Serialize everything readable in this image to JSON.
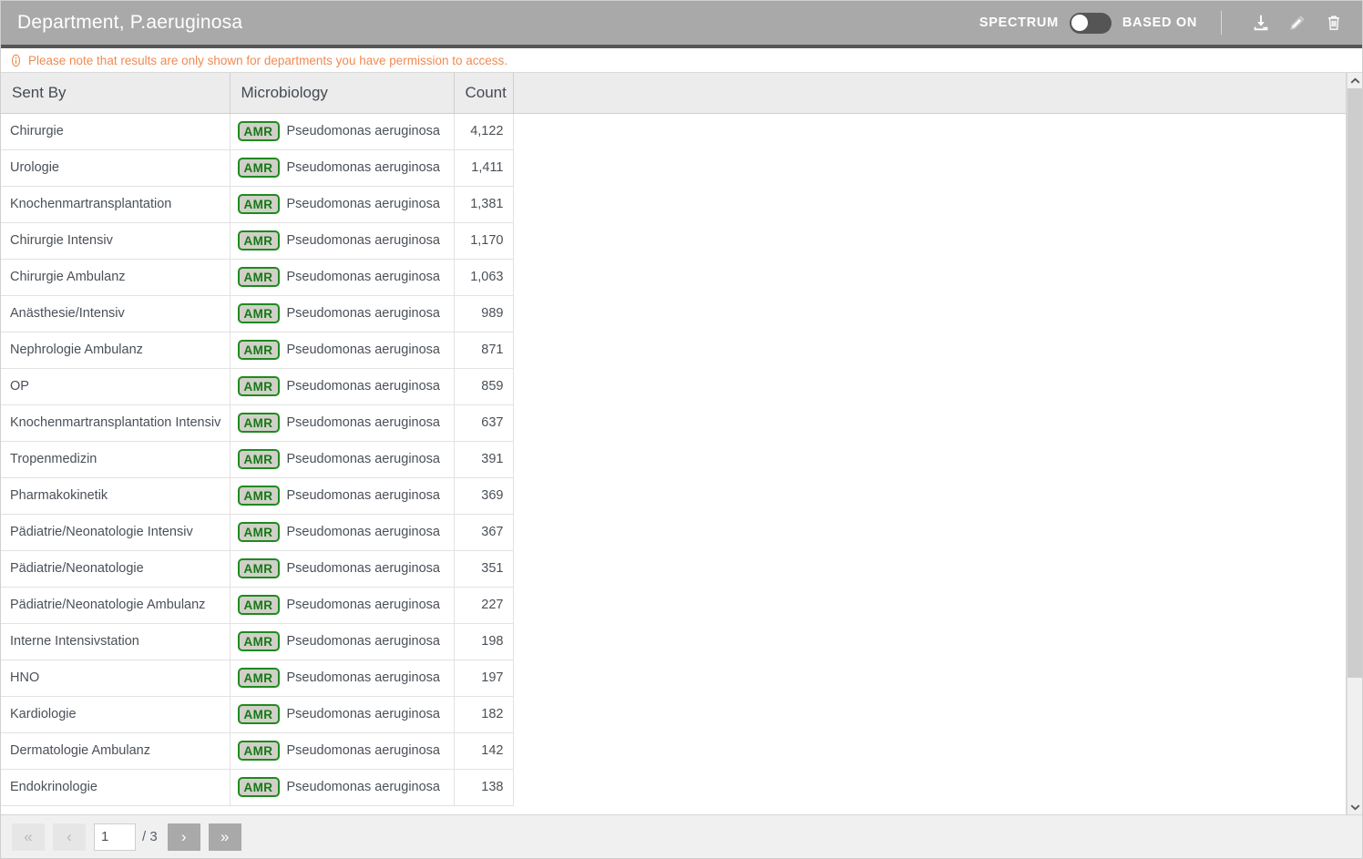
{
  "header": {
    "title": "Department, P.aeruginosa",
    "spectrum_label": "SPECTRUM",
    "based_on_label": "BASED ON",
    "toggle_state": "off",
    "icons": [
      "download-icon",
      "edit-icon",
      "delete-icon"
    ],
    "bar_color": "#a9a9a9",
    "title_color": "#ffffff"
  },
  "notice": {
    "icon": "info-icon",
    "text": "Please note that results are only shown for departments you have permission to access.",
    "color": "#f08a52"
  },
  "table": {
    "columns": [
      "Sent By",
      "Microbiology",
      "Count",
      ""
    ],
    "badge_label": "AMR",
    "badge_border_color": "#1f8a1f",
    "badge_text_color": "#147814",
    "rows": [
      {
        "sent_by": "Chirurgie",
        "badge": "AMR",
        "organism": "Pseudomonas aeruginosa",
        "count": "4,122"
      },
      {
        "sent_by": "Urologie",
        "badge": "AMR",
        "organism": "Pseudomonas aeruginosa",
        "count": "1,411"
      },
      {
        "sent_by": "Knochenmartransplantation",
        "badge": "AMR",
        "organism": "Pseudomonas aeruginosa",
        "count": "1,381"
      },
      {
        "sent_by": "Chirurgie Intensiv",
        "badge": "AMR",
        "organism": "Pseudomonas aeruginosa",
        "count": "1,170"
      },
      {
        "sent_by": "Chirurgie Ambulanz",
        "badge": "AMR",
        "organism": "Pseudomonas aeruginosa",
        "count": "1,063"
      },
      {
        "sent_by": "Anästhesie/Intensiv",
        "badge": "AMR",
        "organism": "Pseudomonas aeruginosa",
        "count": "989"
      },
      {
        "sent_by": "Nephrologie Ambulanz",
        "badge": "AMR",
        "organism": "Pseudomonas aeruginosa",
        "count": "871"
      },
      {
        "sent_by": "OP",
        "badge": "AMR",
        "organism": "Pseudomonas aeruginosa",
        "count": "859"
      },
      {
        "sent_by": "Knochenmartransplantation Intensiv",
        "badge": "AMR",
        "organism": "Pseudomonas aeruginosa",
        "count": "637"
      },
      {
        "sent_by": "Tropenmedizin",
        "badge": "AMR",
        "organism": "Pseudomonas aeruginosa",
        "count": "391"
      },
      {
        "sent_by": "Pharmakokinetik",
        "badge": "AMR",
        "organism": "Pseudomonas aeruginosa",
        "count": "369"
      },
      {
        "sent_by": "Pädiatrie/Neonatologie Intensiv",
        "badge": "AMR",
        "organism": "Pseudomonas aeruginosa",
        "count": "367"
      },
      {
        "sent_by": "Pädiatrie/Neonatologie",
        "badge": "AMR",
        "organism": "Pseudomonas aeruginosa",
        "count": "351"
      },
      {
        "sent_by": "Pädiatrie/Neonatologie Ambulanz",
        "badge": "AMR",
        "organism": "Pseudomonas aeruginosa",
        "count": "227"
      },
      {
        "sent_by": "Interne Intensivstation",
        "badge": "AMR",
        "organism": "Pseudomonas aeruginosa",
        "count": "198"
      },
      {
        "sent_by": "HNO",
        "badge": "AMR",
        "organism": "Pseudomonas aeruginosa",
        "count": "197"
      },
      {
        "sent_by": "Kardiologie",
        "badge": "AMR",
        "organism": "Pseudomonas aeruginosa",
        "count": "182"
      },
      {
        "sent_by": "Dermatologie Ambulanz",
        "badge": "AMR",
        "organism": "Pseudomonas aeruginosa",
        "count": "142"
      },
      {
        "sent_by": "Endokrinologie",
        "badge": "AMR",
        "organism": "Pseudomonas aeruginosa",
        "count": "138"
      }
    ]
  },
  "pagination": {
    "first_label": "«",
    "prev_label": "‹",
    "page_value": "1",
    "total_label": "/ 3",
    "next_label": "›",
    "last_label": "»",
    "first_enabled": false,
    "prev_enabled": false,
    "next_enabled": true,
    "last_enabled": true
  },
  "scrollbar": {
    "up_icon": "chevron-up-icon",
    "down_icon": "chevron-down-icon"
  }
}
